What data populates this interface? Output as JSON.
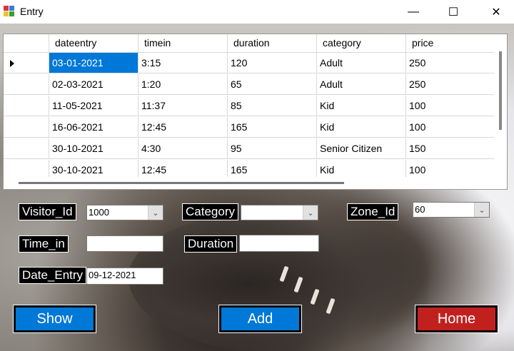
{
  "window": {
    "title": "Entry",
    "minimize_glyph": "—",
    "maximize_glyph": "☐",
    "close_glyph": "✕"
  },
  "grid": {
    "columns": [
      "dateentry",
      "timein",
      "duration",
      "category",
      "price"
    ],
    "rows": [
      [
        "03-01-2021",
        "3:15",
        "120",
        "Adult",
        "250"
      ],
      [
        "02-03-2021",
        "1:20",
        "65",
        "Adult",
        "250"
      ],
      [
        "11-05-2021",
        "11:37",
        "85",
        "Kid",
        "100"
      ],
      [
        "16-06-2021",
        "12:45",
        "165",
        "Kid",
        "100"
      ],
      [
        "30-10-2021",
        "4:30",
        "95",
        "Senior Citizen",
        "150"
      ],
      [
        "30-10-2021",
        "12:45",
        "165",
        "Kid",
        "100"
      ]
    ],
    "selected_row": 0
  },
  "form": {
    "visitor_id_label": "Visitor_Id",
    "visitor_id_value": "1000",
    "category_label": "Category",
    "category_value": "",
    "zone_id_label": "Zone_Id",
    "zone_id_value": "60",
    "time_in_label": "Time_in",
    "time_in_value": "",
    "duration_label": "Duration",
    "duration_value": "",
    "date_entry_label": "Date_Entry",
    "date_entry_value": "09-12-2021"
  },
  "buttons": {
    "show": "Show",
    "add": "Add",
    "home": "Home"
  },
  "colors": {
    "blue_button": "#0078d7",
    "home_button": "#c0211f",
    "selection": "#0078d7"
  },
  "icons": {
    "dropdown": "chevron-down-icon",
    "row_pointer": "row-pointer-icon"
  }
}
